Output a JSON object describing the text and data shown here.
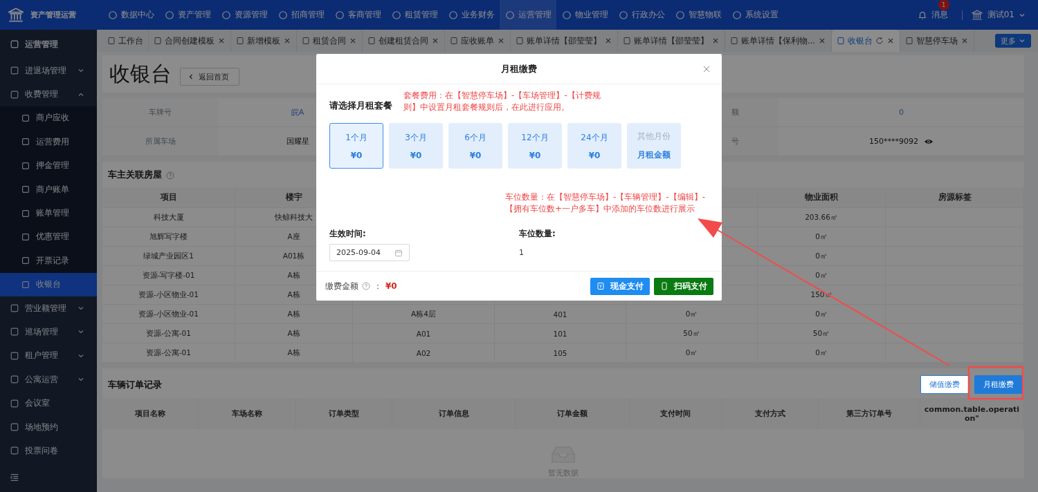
{
  "top_nav": {
    "logo_text": "资产管理运营",
    "menu": [
      {
        "label": "数据中心",
        "selected": false
      },
      {
        "label": "资产管理",
        "selected": false
      },
      {
        "label": "资源管理",
        "selected": false
      },
      {
        "label": "招商管理",
        "selected": false
      },
      {
        "label": "客商管理",
        "selected": false
      },
      {
        "label": "租赁管理",
        "selected": false
      },
      {
        "label": "业务财务",
        "selected": false
      },
      {
        "label": "运营管理",
        "selected": true
      },
      {
        "label": "物业管理",
        "selected": false
      },
      {
        "label": "行政办公",
        "selected": false
      },
      {
        "label": "智慧物联",
        "selected": false
      },
      {
        "label": "系统设置",
        "selected": false
      }
    ],
    "messages": {
      "label": "消息",
      "badge": "1"
    },
    "user": "测试01"
  },
  "sidebar": {
    "title": "运营管理",
    "items": [
      {
        "label": "进退场管理",
        "selected": false,
        "expanded": false
      },
      {
        "label": "收费管理",
        "selected": false,
        "expanded": true,
        "children": [
          {
            "label": "商户应收",
            "selected": false
          },
          {
            "label": "运营费用",
            "selected": false
          },
          {
            "label": "押金管理",
            "selected": false
          },
          {
            "label": "商户账单",
            "selected": false
          },
          {
            "label": "账单管理",
            "selected": false
          },
          {
            "label": "优惠管理",
            "selected": false
          },
          {
            "label": "开票记录",
            "selected": false
          },
          {
            "label": "收银台",
            "selected": true
          }
        ]
      },
      {
        "label": "营业额管理",
        "selected": false,
        "expanded": false
      },
      {
        "label": "巡场管理",
        "selected": false,
        "expanded": false
      },
      {
        "label": "租户管理",
        "selected": false,
        "expanded": false
      },
      {
        "label": "公寓运营",
        "selected": false,
        "expanded": false
      },
      {
        "label": "会议室",
        "selected": false
      },
      {
        "label": "场地预约",
        "selected": false
      },
      {
        "label": "投票问卷",
        "selected": false
      }
    ]
  },
  "tabs": [
    {
      "label": "工作台",
      "selected": false,
      "closable": false
    },
    {
      "label": "合同创建模板",
      "selected": false,
      "closable": true
    },
    {
      "label": "新增模板",
      "selected": false,
      "closable": true
    },
    {
      "label": "租赁合同",
      "selected": false,
      "closable": true
    },
    {
      "label": "创建租赁合同",
      "selected": false,
      "closable": true
    },
    {
      "label": "应收账单",
      "selected": false,
      "closable": true
    },
    {
      "label": "账单详情【邵莹莹】",
      "selected": false,
      "closable": true
    },
    {
      "label": "账单详情【邵莹莹】",
      "selected": false,
      "closable": true
    },
    {
      "label": "账单详情【保利物...",
      "selected": false,
      "closable": true
    },
    {
      "label": "收银台",
      "selected": true,
      "closable": true
    },
    {
      "label": "智慧停车场",
      "selected": false,
      "closable": true
    }
  ],
  "more_button": "更多",
  "page": {
    "title": "收银台",
    "back_button": "返回首页"
  },
  "info": {
    "rows": [
      {
        "cells": [
          {
            "label": "车牌号",
            "value": "皖A",
            "kind": "link"
          },
          {
            "label": "额",
            "value": "0",
            "kind": "link"
          }
        ]
      },
      {
        "cells": [
          {
            "label": "所属车场",
            "value": "国耀星",
            "kind": "text"
          },
          {
            "label": "号",
            "value": "150****9092",
            "kind": "masked"
          }
        ]
      }
    ]
  },
  "houses": {
    "title": "车主关联房屋",
    "columns": [
      "项目",
      "楼宇",
      null,
      null,
      null,
      "物业面积",
      "房源标签"
    ],
    "rows": [
      {
        "cells": [
          "科技大厦",
          "快鲸科技大",
          null,
          null,
          null,
          "203.66㎡",
          null
        ]
      },
      {
        "cells": [
          "旭辉写字楼",
          "A座",
          null,
          null,
          null,
          "0㎡",
          null
        ]
      },
      {
        "cells": [
          "绿城产业园区1",
          "A01栋",
          null,
          null,
          null,
          "0㎡",
          null
        ]
      },
      {
        "cells": [
          "资源-写字楼-01",
          "A栋",
          null,
          null,
          null,
          "0㎡",
          null
        ]
      },
      {
        "cells": [
          "资源-小区物业-01",
          "A栋",
          null,
          null,
          null,
          "150㎡",
          null
        ]
      },
      {
        "cells": [
          "资源-小区物业-01",
          "A栋",
          "A栋4层",
          "401",
          "0㎡",
          "0㎡",
          null
        ]
      },
      {
        "cells": [
          "资源-公寓-01",
          "A栋",
          "A01",
          "101",
          "50㎡",
          "50㎡",
          null
        ]
      },
      {
        "cells": [
          "资源-公寓-01",
          "A栋",
          "A02",
          "105",
          "0㎡",
          "0㎡",
          null
        ]
      }
    ]
  },
  "orders": {
    "title": "车辆订单记录",
    "buttons": [
      {
        "label": "储值缴费",
        "kind": "outline"
      },
      {
        "label": "月租缴费",
        "kind": "primary"
      }
    ],
    "columns": [
      "项目名称",
      "车场名称",
      "订单类型",
      "订单信息",
      "订单金额",
      "支付时间",
      "支付方式",
      "第三方订单号",
      "common.table.operation\""
    ],
    "empty_text": "暂无数据"
  },
  "modal": {
    "title": "月租缴费",
    "package_label": "请选择月租套餐",
    "package_note": "套餐费用：在【智慧停车场】-【车场管理】-【计费规则】中设置月租套餐规则后，在此进行应用。",
    "packages": [
      {
        "period": "1个月",
        "price": "¥0",
        "kind": "preset",
        "selected": true
      },
      {
        "period": "3个月",
        "price": "¥0",
        "kind": "preset",
        "selected": false
      },
      {
        "period": "6个月",
        "price": "¥0",
        "kind": "preset",
        "selected": false
      },
      {
        "period": "12个月",
        "price": "¥0",
        "kind": "preset",
        "selected": false
      },
      {
        "period": "24个月",
        "price": "¥0",
        "kind": "preset",
        "selected": false
      },
      {
        "period": "其他月份",
        "price": "月租金额",
        "kind": "custom",
        "selected": false
      }
    ],
    "spaces_note": "车位数量：在【智慧停车场】-【车辆管理】-【编辑】-【拥有车位数+一户多车】中添加的车位数进行展示",
    "start_label": "生效时间:",
    "start_date": "2025-09-04",
    "spaces_label": "车位数量:",
    "spaces_value": "1",
    "fee_label": "缴费金额",
    "fee_separator": "：",
    "fee_amount": "¥0",
    "buttons": [
      {
        "label": "现金支付",
        "kind": "cash"
      },
      {
        "label": "扫码支付",
        "kind": "scan"
      }
    ]
  }
}
